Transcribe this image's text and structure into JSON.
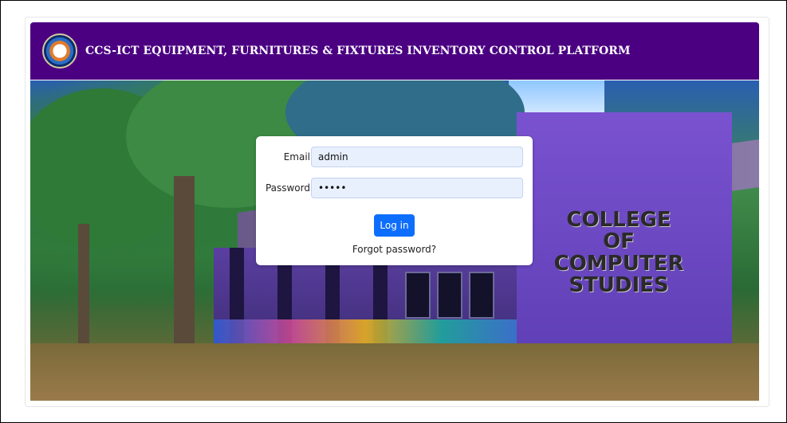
{
  "header": {
    "title": "CCS-ICT EQUIPMENT, FURNITURES & FIXTURES INVENTORY CONTROL PLATFORM",
    "logo_icon": "college-seal-icon"
  },
  "hero": {
    "sign_lines": [
      "COLLEGE",
      "OF",
      "COMPUTER STUDIES"
    ]
  },
  "login": {
    "email_label": "Email",
    "email_value": "admin",
    "password_label": "Password",
    "password_value": "•••••",
    "login_button": "Log in",
    "forgot_link": "Forgot password?"
  },
  "colors": {
    "header_bg": "#4b0082",
    "primary_button": "#0d6efd",
    "input_bg": "#e8f0fe"
  }
}
